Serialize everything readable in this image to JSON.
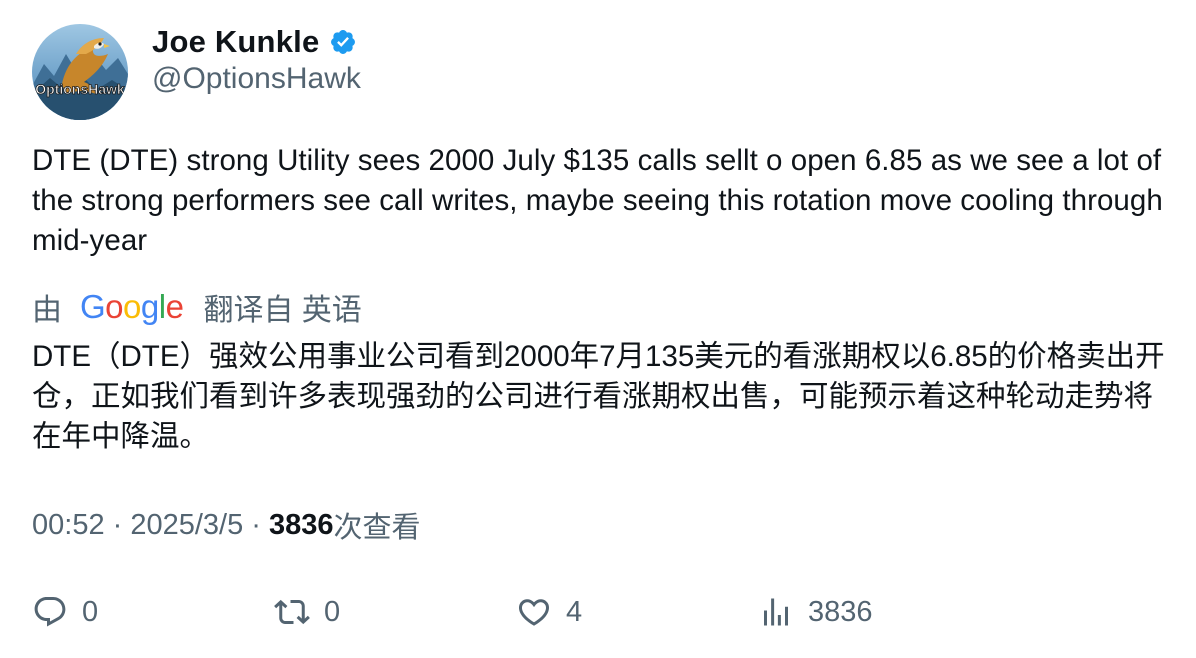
{
  "author": {
    "display_name": "Joe Kunkle",
    "handle": "@OptionsHawk",
    "verified": true,
    "avatar_icon": "hawk-logo-avatar",
    "avatar_logo_text": "OptionsHawk"
  },
  "tweet": {
    "text": "DTE (DTE) strong Utility sees 2000 July $135 calls sellt o open 6.85 as we see a lot of the strong performers see call writes, maybe seeing this rotation move cooling through mid-year"
  },
  "translation": {
    "prefix": "由",
    "provider": "Google",
    "suffix": "翻译自 英语",
    "text": "DTE（DTE）强效公用事业公司看到2000年7月135美元的看涨期权以6.85的价格卖出开仓，正如我们看到许多表现强劲的公司进行看涨期权出售，可能预示着这种轮动走势将在年中降温。"
  },
  "meta": {
    "time": "00:52",
    "separator": " · ",
    "date": "2025/3/5",
    "views_count": "3836",
    "views_label": "次查看"
  },
  "actions": {
    "reply": {
      "icon": "reply-icon",
      "count": "0"
    },
    "retweet": {
      "icon": "retweet-icon",
      "count": "0"
    },
    "like": {
      "icon": "heart-icon",
      "count": "4"
    },
    "views": {
      "icon": "analytics-icon",
      "count": "3836"
    }
  },
  "colors": {
    "text_primary": "#0f1419",
    "text_secondary": "#536471",
    "verified_blue": "#1d9bf0",
    "google_blue": "#4285f4",
    "google_red": "#ea4335",
    "google_yellow": "#fbbc05",
    "google_green": "#34a853"
  }
}
